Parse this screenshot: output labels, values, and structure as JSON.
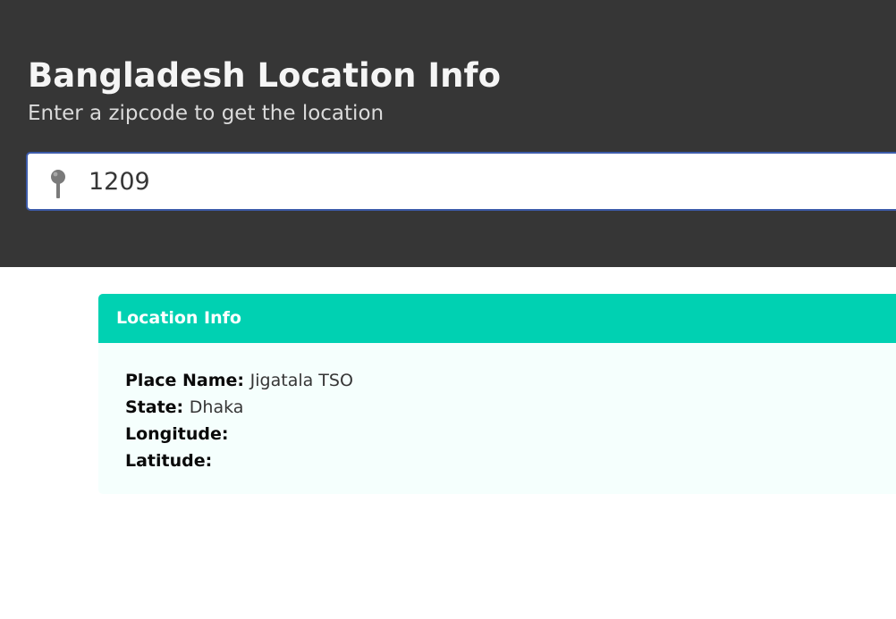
{
  "hero": {
    "title": "Bangladesh Location Info",
    "subtitle": "Enter a zipcode to get the location"
  },
  "search": {
    "value": "1209",
    "icon": "map-pin-icon"
  },
  "location_card": {
    "title": "Location Info",
    "rows": [
      {
        "label": "Place Name:",
        "value": "Jigatala TSO"
      },
      {
        "label": "State:",
        "value": "Dhaka"
      },
      {
        "label": "Longitude:",
        "value": ""
      },
      {
        "label": "Latitude:",
        "value": ""
      }
    ]
  },
  "colors": {
    "hero_background": "#363636",
    "card_header": "#00d1b2",
    "card_body": "#f5fffd",
    "input_border": "#3d5ba9"
  }
}
